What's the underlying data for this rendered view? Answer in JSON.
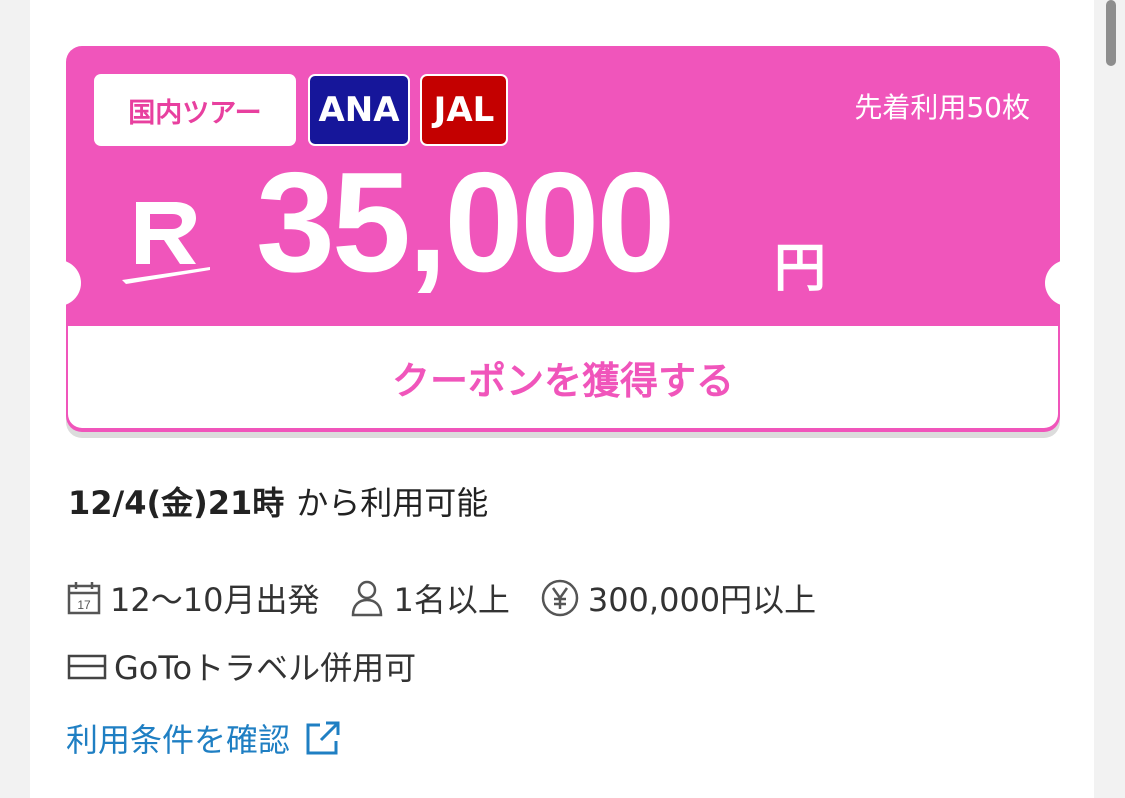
{
  "coupon": {
    "badges": {
      "domestic": "国内ツアー",
      "ana": "ANA",
      "jal": "JAL"
    },
    "limit_text": "先着利用50枚",
    "amount": "35,000",
    "currency": "円",
    "get_button_label": "クーポンを獲得する",
    "colors": {
      "pink": "#f055bb",
      "ana": "#16169a",
      "jal": "#c40000"
    }
  },
  "availability": {
    "datetime": "12/4(金)21時",
    "suffix": "から利用可能"
  },
  "conditions": {
    "departure": "12〜10月出発",
    "people": "1名以上",
    "min_price": "300,000円以上",
    "goto": "GoToトラベル併用可"
  },
  "terms_link": {
    "label": "利用条件を確認"
  }
}
